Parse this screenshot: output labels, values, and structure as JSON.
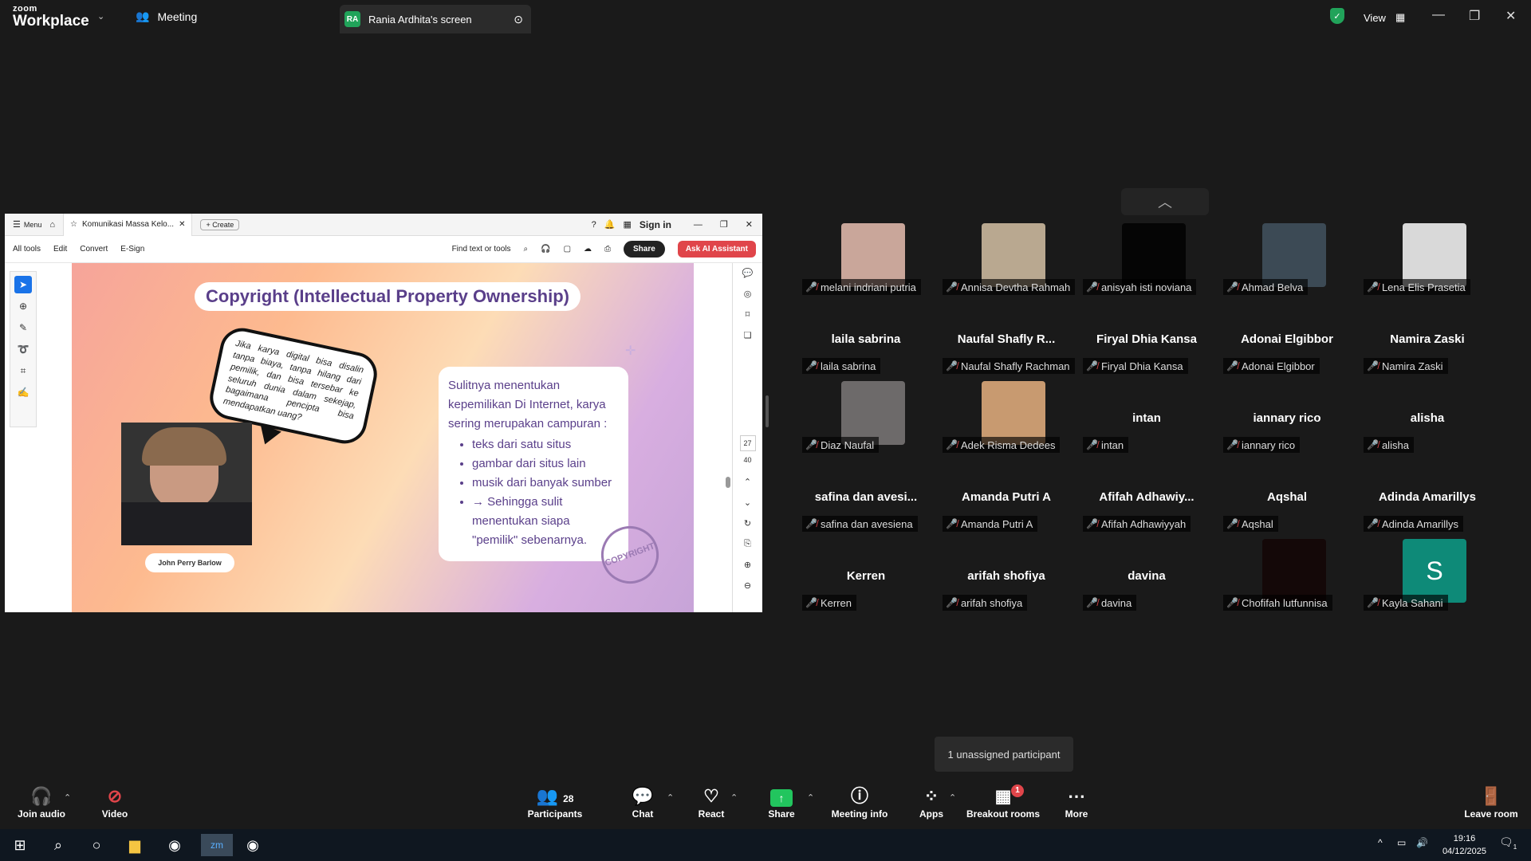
{
  "titlebar": {
    "logo_top": "zoom",
    "logo_bottom": "Workplace",
    "meeting_tab": "Meeting",
    "share_tab_initials": "RA",
    "share_tab_label": "Rania Ardhita's screen",
    "view_label": "View"
  },
  "shared": {
    "menu": "Menu",
    "doc_tab": "Komunikasi Massa Kelo...",
    "create": "Create",
    "sign_in": "Sign in",
    "tools": [
      "All tools",
      "Edit",
      "Convert",
      "E-Sign"
    ],
    "find": "Find text or tools",
    "share_btn": "Share",
    "ai_btn": "Ask AI Assistant",
    "page_current": "27",
    "page_total": "40",
    "slide": {
      "title": "Copyright (Intellectual Property Ownership)",
      "bubble": "Jika karya digital bisa disalin tanpa biaya, tanpa hilang dari pemilik, dan bisa tersebar ke seluruh dunia dalam sekejap, bagaimana pencipta bisa mendapatkan uang?",
      "person": "John Perry Barlow",
      "card_intro": "Sulitnya menentukan kepemilikan Di Internet, karya sering merupakan campuran :",
      "card_items": [
        "teks dari satu situs",
        "gambar dari situs lain",
        "musik dari banyak sumber",
        "→ Sehingga sulit menentukan siapa \"pemilik\" sebenarnya."
      ],
      "stamp": "COPYRIGHT"
    }
  },
  "gallery": [
    {
      "big": "",
      "label": "melani indriani putria",
      "photo": "#c9a69a"
    },
    {
      "big": "",
      "label": "Annisa Devtha Rahmah",
      "photo": "#b9a890"
    },
    {
      "big": "",
      "label": "anisyah isti noviana",
      "photo": "#050505"
    },
    {
      "big": "",
      "label": "Ahmad Belva",
      "photo": "#3c4a55"
    },
    {
      "big": "",
      "label": "Lena Elis Prasetia",
      "photo": "#d9d9d9"
    },
    {
      "big": "laila sabrina",
      "label": "laila sabrina",
      "photo": ""
    },
    {
      "big": "Naufal Shafly R...",
      "label": "Naufal Shafly Rachman",
      "photo": ""
    },
    {
      "big": "Firyal Dhia Kansa",
      "label": "Firyal Dhia Kansa",
      "photo": ""
    },
    {
      "big": "Adonai Elgibbor",
      "label": "Adonai Elgibbor",
      "photo": ""
    },
    {
      "big": "Namira Zaski",
      "label": "Namira Zaski",
      "photo": ""
    },
    {
      "big": "",
      "label": "Diaz Naufal",
      "photo": "#6d6a6a"
    },
    {
      "big": "",
      "label": "Adek Risma Dedees",
      "photo": "#c89a70"
    },
    {
      "big": "intan",
      "label": "intan",
      "photo": ""
    },
    {
      "big": "iannary rico",
      "label": "iannary rico",
      "photo": ""
    },
    {
      "big": "alisha",
      "label": "alisha",
      "photo": ""
    },
    {
      "big": "safina dan avesi...",
      "label": "safina dan avesiena",
      "photo": ""
    },
    {
      "big": "Amanda Putri A",
      "label": "Amanda Putri A",
      "photo": ""
    },
    {
      "big": "Afifah Adhawiy...",
      "label": "Afifah Adhawiyyah",
      "photo": ""
    },
    {
      "big": "Aqshal",
      "label": "Aqshal",
      "photo": ""
    },
    {
      "big": "Adinda Amarillys",
      "label": "Adinda Amarillys",
      "photo": ""
    },
    {
      "big": "Kerren",
      "label": "Kerren",
      "photo": ""
    },
    {
      "big": "arifah shofiya",
      "label": "arifah shofiya",
      "photo": ""
    },
    {
      "big": "davina",
      "label": "davina",
      "photo": ""
    },
    {
      "big": "",
      "label": "Chofifah lutfunnisa",
      "photo": "#140808"
    },
    {
      "big": "S",
      "label": "Kayla Sahani",
      "photo": "#0e8a78"
    }
  ],
  "tooltip": "1 unassigned participant",
  "toolbar": {
    "join_audio": "Join audio",
    "video": "Video",
    "participants": "Participants",
    "participants_count": "28",
    "chat": "Chat",
    "react": "React",
    "share": "Share",
    "meeting_info": "Meeting info",
    "apps": "Apps",
    "breakout": "Breakout rooms",
    "breakout_badge": "1",
    "more": "More",
    "leave": "Leave room"
  },
  "taskbar": {
    "time": "19:16",
    "date": "04/12/2025",
    "notif": "1"
  },
  "colors": {
    "accent_green": "#21a35a",
    "share_green": "#22c55e",
    "ai_red": "#e0454a",
    "slide_purple": "#5a3f8a"
  }
}
